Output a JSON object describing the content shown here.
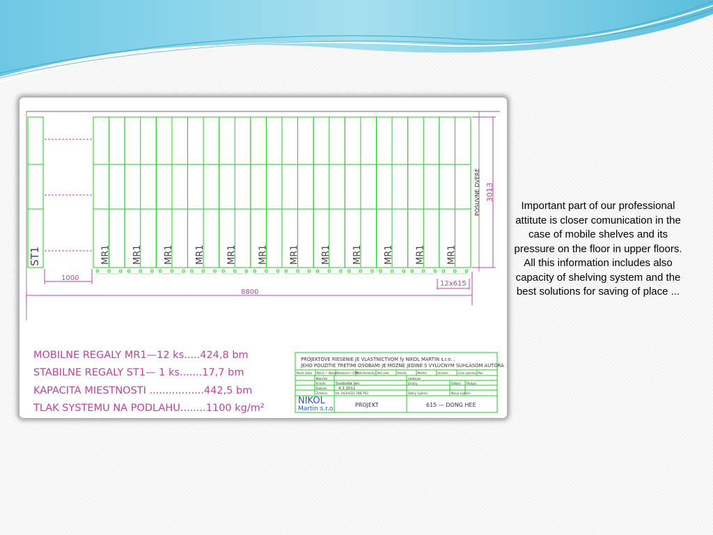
{
  "caption": "Important part of our professional attitute is closer comunication in the case of mobile shelves and its pressure on the floor in upper floors. All this information includes also capacity of  shelving system and the best solutions for saving of place ...",
  "drawing": {
    "stable_label": "ST1",
    "mobile_label": "MR1",
    "mobile_count": 12,
    "door_label": "POSUVNE DVERE",
    "dim_height": "3013",
    "dim_gap": "1000",
    "dim_total": "8800",
    "dim_units": "12x615"
  },
  "summary": [
    "MOBILNE  REGALY  MR1—12  ks.....424,8  bm",
    "STABILNE  REGALY  ST1—  1  ks.......17,7  bm",
    "KAPACITA  MIESTNOSTI  .................442,5  bm",
    "TLAK  SYSTEMU  NA  PODLAHU........1100  kg/m²"
  ],
  "title_block": {
    "notice_1": "PROJEKTOVE RIESENIE JE VLASTNICTVOM fy NIKOL MARTIN s.r.o. ,",
    "notice_2": "JEHO POUZITIE TRETIMI OSOBAMI JE MOZNE JEDINE S VYLUCNYM SUHLASOM AUTORA",
    "row_header": [
      "Pocet listov",
      "Meno — Nazov",
      "Polotovar—STN",
      "Mat.Komenty",
      "Akt.cislo",
      "Hmota",
      "Mierka",
      "Urcenie",
      "Cislo vykresu",
      "Pos"
    ],
    "labels": [
      "Nacrtol",
      "Kreslil",
      "Datum",
      "Zmena"
    ],
    "kreslil": "Svoboda Jan",
    "datum": "4.3.2011",
    "phone": "tel. 043/4321 786,783",
    "firm_name": "NIKOL",
    "firm_sub": "Martin s.r.o",
    "project_label": "PROJEKT",
    "project_code": "615 — DONG HEE",
    "misc": [
      "Vedenie",
      "Druhy",
      "Stary vykres",
      "Novy vykres",
      "Odbor",
      "Podpis"
    ]
  },
  "colors": {
    "shelf_green": "#22cc22",
    "dim_magenta": "#c0409a",
    "frame_gray": "#888888"
  }
}
